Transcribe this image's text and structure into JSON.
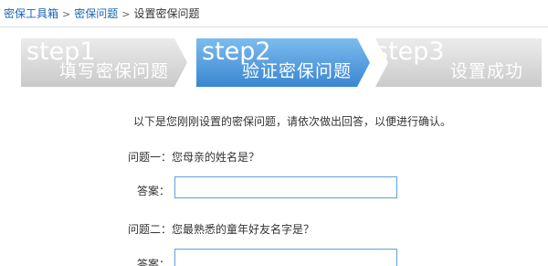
{
  "breadcrumb": {
    "items": [
      "密保工具箱",
      "密保问题"
    ],
    "separator": ">",
    "current": "设置密保问题"
  },
  "steps": [
    {
      "num": "step1",
      "label": "填写密保问题",
      "state": "done"
    },
    {
      "num": "step2",
      "label": "验证密保问题",
      "state": "active"
    },
    {
      "num": "step3",
      "label": "设置成功",
      "state": "pending"
    }
  ],
  "intro": "以下是您刚刚设置的密保问题，请依次做出回答，以便进行确认。",
  "questions": [
    {
      "label": "问题一：",
      "text": "您母亲的姓名是？",
      "answer_label": "答案：",
      "answer_value": ""
    },
    {
      "label": "问题二：",
      "text": "您最熟悉的童年好友名字是？",
      "answer_label": "答案：",
      "answer_value": ""
    }
  ],
  "colors": {
    "link": "#1a66b3",
    "active_step": "#3a86d1",
    "inactive_step": "#c9c9c9",
    "input_border": "#5fa2d9"
  }
}
